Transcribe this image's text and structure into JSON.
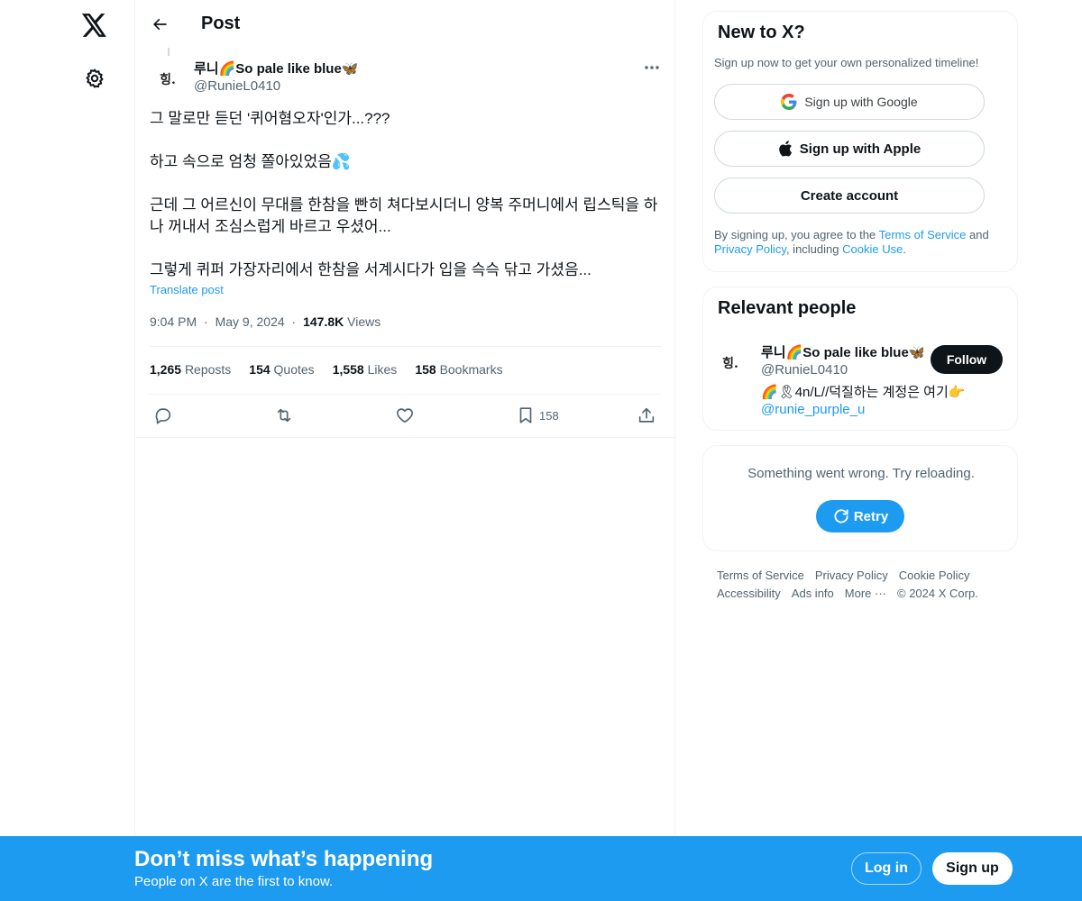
{
  "nav": {
    "logo_icon": "x-logo-icon",
    "settings_icon": "gear-icon"
  },
  "header": {
    "title": "Post",
    "back_icon": "arrow-left-icon"
  },
  "post": {
    "author_name": "루니🌈So pale like blue🦋",
    "author_handle": "@RunieL0410",
    "avatar_text": "힝.",
    "paragraphs": [
      "그 말로만 듣던 '퀴어혐오자'인가...???",
      "하고 속으로 엄청 쫄아있었음💦",
      "근데 그 어르신이 무대를 한참을 빤히 쳐다보시더니 양복 주머니에서 립스틱을 하나 꺼내서 조심스럽게 바르고 우셨어...",
      "그렇게 퀴퍼 가장자리에서 한참을 서계시다가 입을 슥슥 닦고 가셨음..."
    ],
    "translate": "Translate post",
    "time": "9:04 PM",
    "date": "May 9, 2024",
    "views_count": "147.8K",
    "views_label": "Views",
    "separator": "·",
    "stats": {
      "reposts_count": "1,265",
      "reposts_label": "Reposts",
      "quotes_count": "154",
      "quotes_label": "Quotes",
      "likes_count": "1,558",
      "likes_label": "Likes",
      "bookmarks_count": "158",
      "bookmarks_label": "Bookmarks"
    },
    "actions": {
      "bookmark_count": "158"
    }
  },
  "sidebar": {
    "new_to_x": {
      "title": "New to X?",
      "subtitle": "Sign up now to get your own personalized timeline!",
      "google_label": "Sign up with Google",
      "apple_label": "Sign up with Apple",
      "create_label": "Create account",
      "legal_prefix": "By signing up, you agree to the ",
      "terms": "Terms of Service",
      "and": " and ",
      "privacy": "Privacy Policy",
      "including": ", including ",
      "cookie": "Cookie Use",
      "period": "."
    },
    "relevant": {
      "title": "Relevant people",
      "name": "루니🌈So pale like blue🦋",
      "handle": "@RunieL0410",
      "avatar_text": "힝.",
      "follow_label": "Follow",
      "bio": "🌈🎗4n/L//덕질하는 계정은 여기👉",
      "bio_link": "@runie_purple_u"
    },
    "error": {
      "text": "Something went wrong. Try reloading.",
      "retry_label": "Retry"
    },
    "footer": {
      "terms": "Terms of Service",
      "privacy": "Privacy Policy",
      "cookie": "Cookie Policy",
      "accessibility": "Accessibility",
      "ads": "Ads info",
      "more": "More ···",
      "copyright": "© 2024 X Corp."
    }
  },
  "banner": {
    "title": "Don’t miss what’s happening",
    "subtitle": "People on X are the first to know.",
    "login_label": "Log in",
    "signup_label": "Sign up"
  },
  "colors": {
    "accent": "#1d9bf0",
    "text": "#0f1419",
    "muted": "#536471",
    "border": "#eff3f4"
  }
}
